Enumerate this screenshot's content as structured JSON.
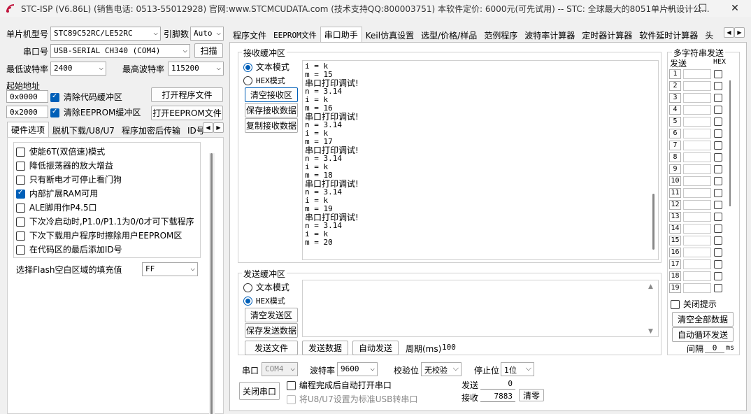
{
  "window": {
    "title": "STC-ISP (V6.86L) (销售电话: 0513-55012928) 官网:www.STCMCUDATA.com  (技术支持QQ:800003751) 本软件定价: 6000元(可先试用) -- STC: 全球最大的8051单片机设计公...",
    "minimize": "—",
    "maximize": "☐",
    "close": "✕"
  },
  "left": {
    "mcu_type_label": "单片机型号",
    "mcu_type_value": "STC89C52RC/LE52RC",
    "pins_label": "引脚数",
    "pins_value": "Auto",
    "port_label": "串口号",
    "port_value": "USB-SERIAL CH340 (COM4)",
    "scan_button": "扫描",
    "min_baud_label": "最低波特率",
    "min_baud_value": "2400",
    "max_baud_label": "最高波特率",
    "max_baud_value": "115200",
    "start_addr_label": "起始地址",
    "addr1_value": "0x0000",
    "clear_code_label": "清除代码缓冲区",
    "open_program_button": "打开程序文件",
    "addr2_value": "0x2000",
    "clear_eeprom_label": "清除EEPROM缓冲区",
    "open_eeprom_button": "打开EEPROM文件",
    "tabs": [
      "硬件选项",
      "脱机下载/U8/U7",
      "程序加密后传输",
      "ID号"
    ],
    "options": [
      {
        "label": "使能6T(双倍速)模式",
        "checked": false
      },
      {
        "label": "降低振荡器的放大增益",
        "checked": false
      },
      {
        "label": "只有断电才可停止看门狗",
        "checked": false
      },
      {
        "label": "内部扩展RAM可用",
        "checked": true
      },
      {
        "label": "ALE脚用作P4.5口",
        "checked": false
      },
      {
        "label": "下次冷启动时,P1.0/P1.1为0/0才可下载程序",
        "checked": false
      },
      {
        "label": "下次下载用户程序时擦除用户EEPROM区",
        "checked": false
      },
      {
        "label": "在代码区的最后添加ID号",
        "checked": false
      }
    ],
    "flash_fill_label": "选择Flash空白区域的填充值",
    "flash_fill_value": "FF"
  },
  "main_tabs": [
    "程序文件",
    "EEPROM文件",
    "串口助手",
    "Keil仿真设置",
    "选型/价格/样品",
    "范例程序",
    "波特率计算器",
    "定时器计算器",
    "软件延时计算器",
    "头"
  ],
  "active_main_tab": 2,
  "receive": {
    "title": "接收缓冲区",
    "text_mode": "文本模式",
    "hex_mode": "HEX模式",
    "clear_button": "清空接收区",
    "save_button": "保存接收数据",
    "copy_button": "复制接收数据",
    "lines": [
      "i = k",
      "m = 15",
      "串口打印调试!",
      "n = 3.14",
      "i = k",
      "m = 16",
      "串口打印调试!",
      "n = 3.14",
      "i = k",
      "m = 17",
      "串口打印调试!",
      "n = 3.14",
      "i = k",
      "m = 18",
      "串口打印调试!",
      "n = 3.14",
      "i = k",
      "m = 19",
      "串口打印调试!",
      "n = 3.14",
      "i = k",
      "m = 20"
    ]
  },
  "send": {
    "title": "发送缓冲区",
    "text_mode": "文本模式",
    "hex_mode": "HEX模式",
    "clear_button": "清空发送区",
    "save_button": "保存发送数据",
    "send_file_button": "发送文件",
    "send_data_button": "发送数据",
    "auto_send_button": "自动发送",
    "period_label": "周期(ms)",
    "period_value": "100"
  },
  "serial": {
    "port_label": "串口",
    "port_value": "COM4",
    "baud_label": "波特率",
    "baud_value": "9600",
    "parity_label": "校验位",
    "parity_value": "无校验",
    "stopbits_label": "停止位",
    "stopbits_value": "1位",
    "close_port_button": "关闭串口",
    "auto_open_label": "编程完成后自动打开串口",
    "u8u7_label": "将U8/U7设置为标准USB转串口",
    "sent_label": "发送",
    "sent_value": "0",
    "recv_label": "接收",
    "recv_value": "7883",
    "clear_counts_button": "清零"
  },
  "multi_send": {
    "title": "多字符串发送",
    "send_header": "发送",
    "hex_header": "HEX",
    "rows": [
      "1",
      "2",
      "3",
      "4",
      "5",
      "6",
      "7",
      "8",
      "9",
      "10",
      "11",
      "12",
      "13",
      "14",
      "15",
      "16",
      "17",
      "18",
      "19"
    ],
    "close_tip_label": "关闭提示",
    "clear_all_button": "清空全部数据",
    "auto_loop_button": "自动循环发送",
    "interval_label": "间隔",
    "interval_value": "0",
    "interval_unit": "ms"
  },
  "icons": {
    "app": "stc-logo-icon",
    "dropdown": "chevron-down-icon"
  },
  "colors": {
    "accent": "#005fb8",
    "logo": "#c0143c"
  }
}
